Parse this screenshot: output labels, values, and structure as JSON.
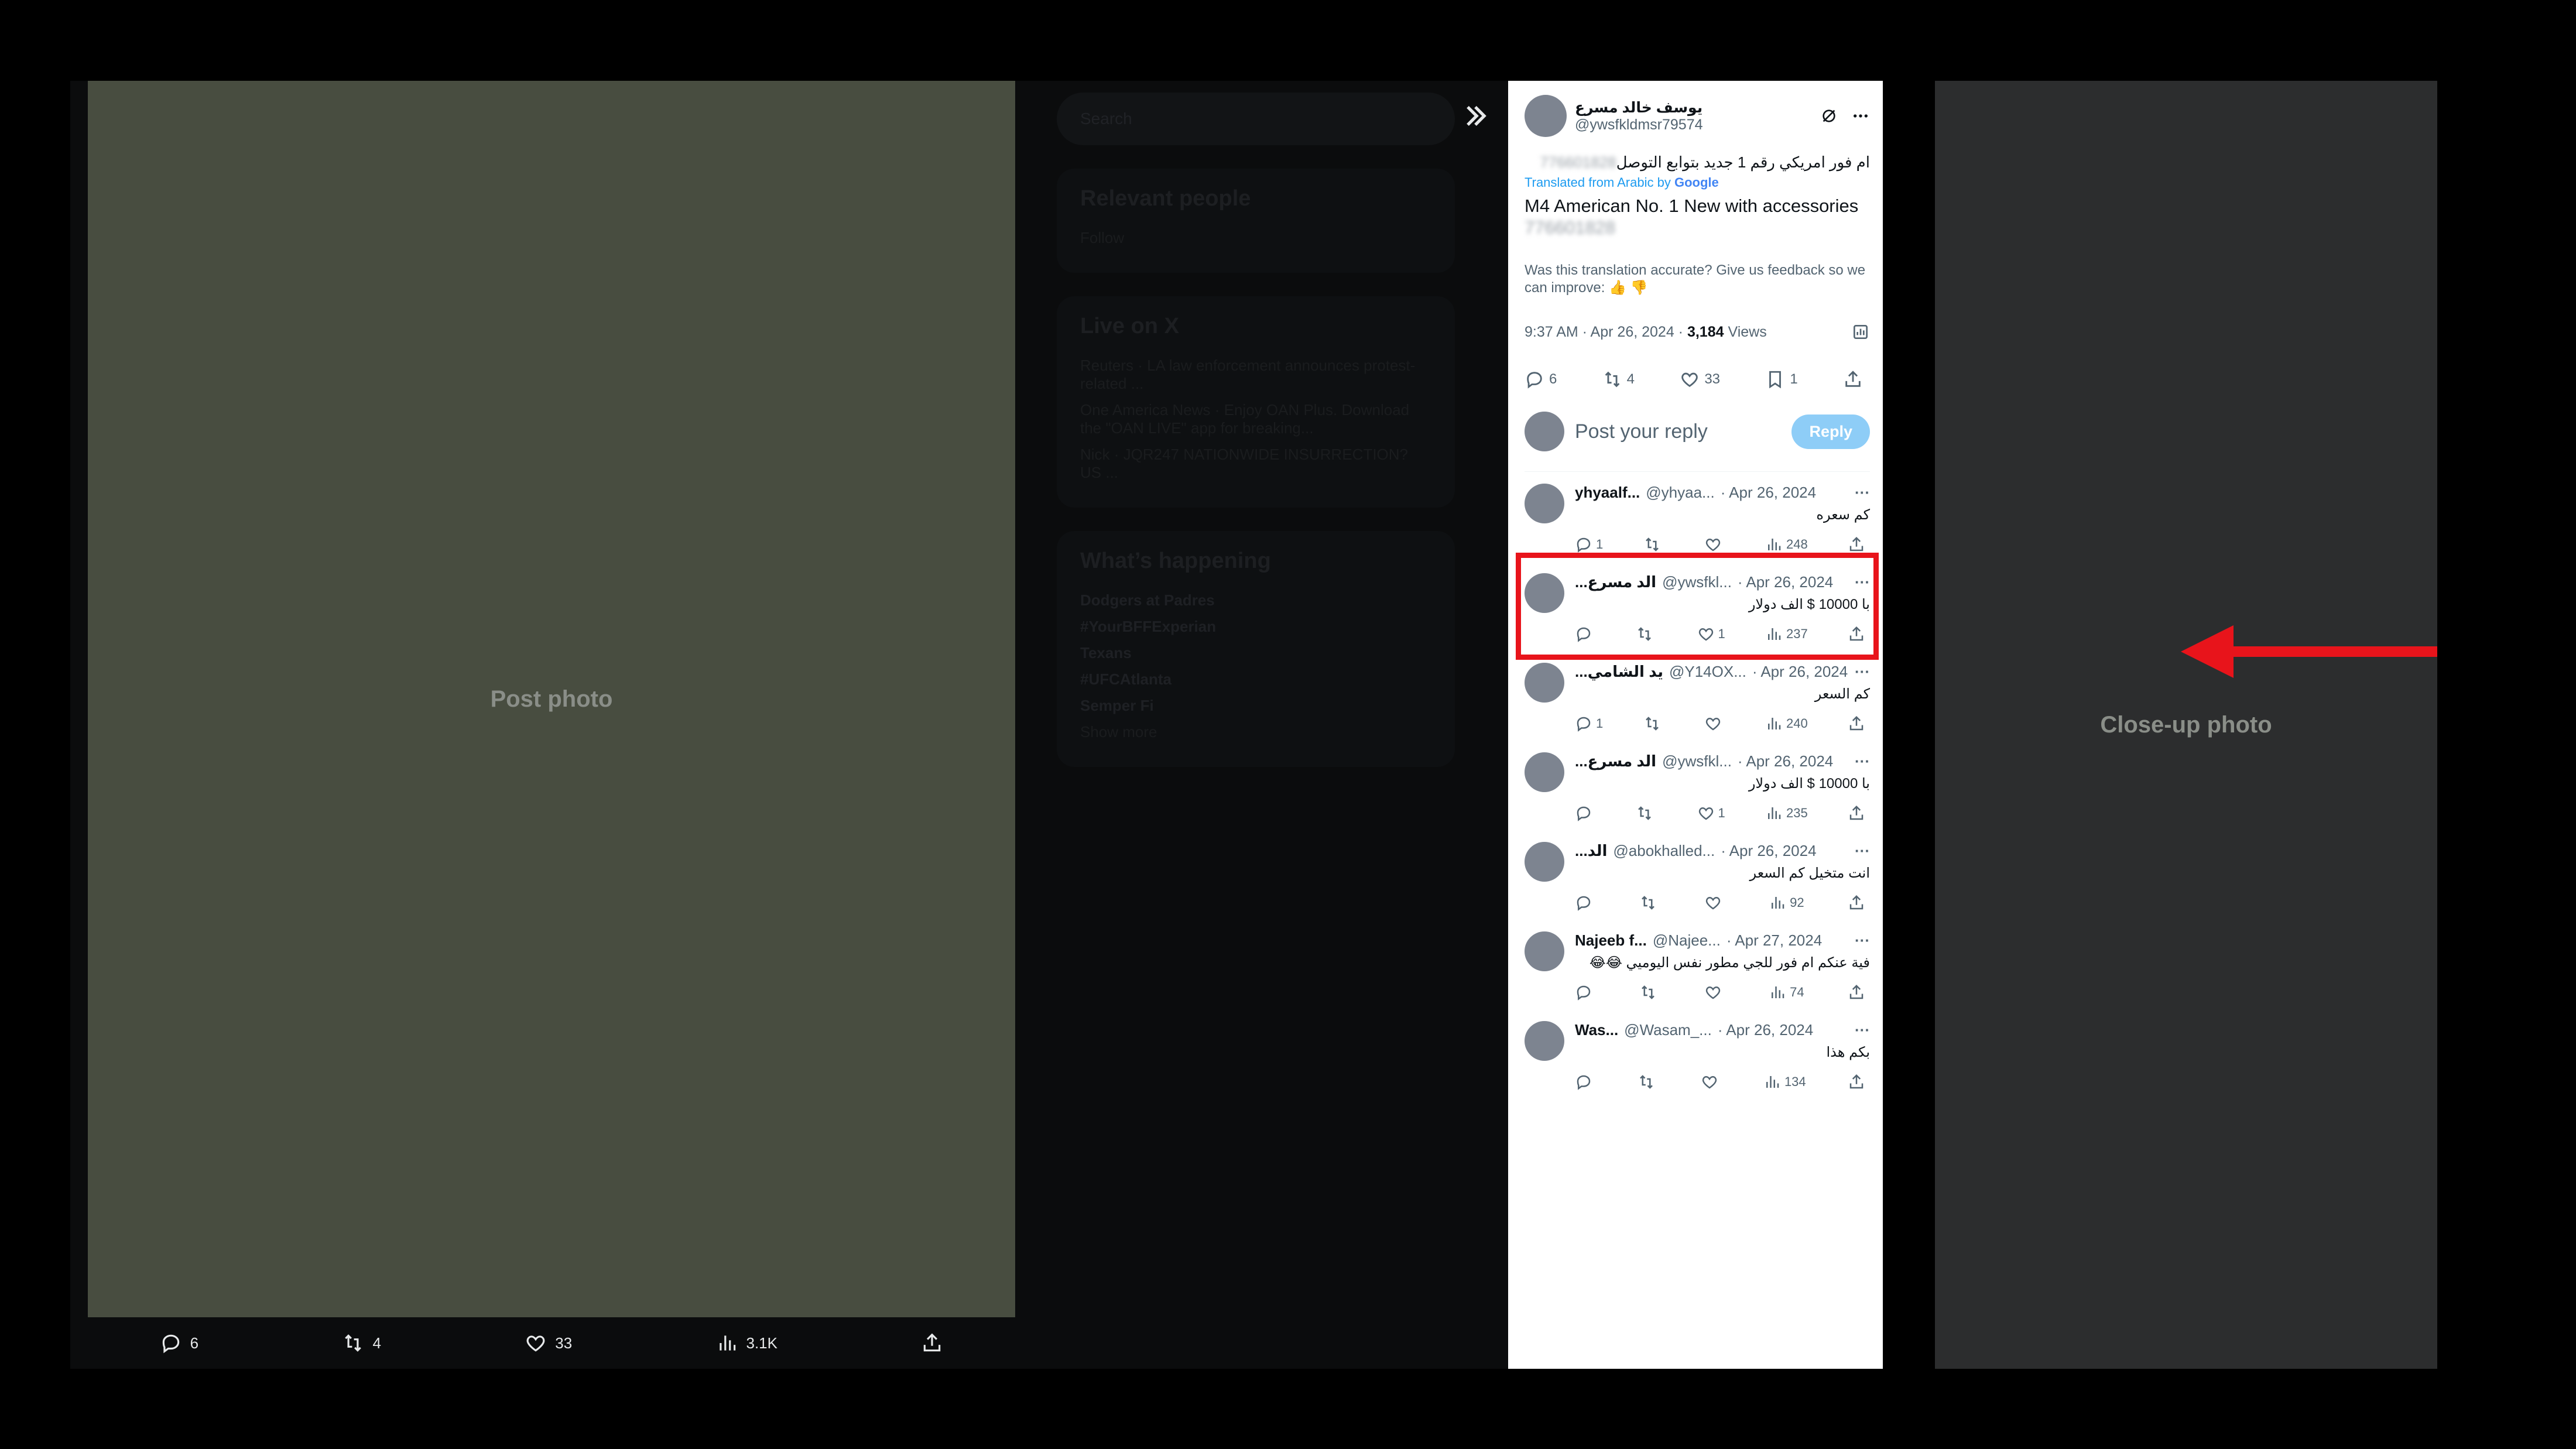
{
  "backdrop": {
    "search_placeholder": "Search",
    "relevant_people_title": "Relevant people",
    "follow_label": "Follow",
    "live_title": "Live on X",
    "live_items": [
      "Reuters · LA law enforcement announces protest-related ...",
      "One America News · Enjoy OAN Plus. Download the \"OAN LIVE\" app for breaking...",
      "Nick · JQR247 NATIONWIDE INSURRECTION? US ..."
    ],
    "whats_happening_title": "What’s happening",
    "trends": [
      "Dodgers at Padres",
      "#YourBFFExperian",
      "Texans",
      "#UFCAtlanta",
      "Semper Fi"
    ],
    "show_more": "Show more"
  },
  "viewer": {
    "main_photo_label": "Post photo",
    "closeup_photo_label": "Close-up photo",
    "actions": {
      "replies": "6",
      "reposts": "4",
      "likes": "33",
      "views": "3.1K"
    }
  },
  "tweet": {
    "author_name": "يوسف خالد مسرع",
    "author_handle": "@ywsfkldmsr79574",
    "text_ar": "ام فور امريكي رقم 1 جديد بتوابع التوصل",
    "text_ar_blurred": "776601828",
    "translated_from": "Translated from Arabic by",
    "google": "Google",
    "text_en": "M4 American No. 1 New with accessories",
    "text_en_blurred": "776601828",
    "feedback": "Was this translation accurate? Give us feedback so we can improve:",
    "timestamp": "9:37 AM · Apr 26, 2024 ·",
    "views_count": "3,184",
    "views_label": "Views",
    "stats": {
      "replies": "6",
      "reposts": "4",
      "likes": "33",
      "bookmarks": "1"
    },
    "reply_placeholder": "Post your reply",
    "reply_button": "Reply"
  },
  "replies": [
    {
      "name": "yhyaalf...",
      "handle": "@yhyaa...",
      "date": "· Apr 26, 2024",
      "text": "كم سعره",
      "replies": "1",
      "reposts": "",
      "likes": "",
      "views": "248",
      "highlight": false
    },
    {
      "name": "...الد مسرع",
      "handle": "@ywsfkl...",
      "date": "· Apr 26, 2024",
      "text": "با 10000 $ الف دولار",
      "replies": "",
      "reposts": "",
      "likes": "1",
      "views": "237",
      "highlight": true
    },
    {
      "name": "...يد الشامي",
      "handle": "@Y14OX...",
      "date": "· Apr 26, 2024",
      "text": "كم السعر",
      "replies": "1",
      "reposts": "",
      "likes": "",
      "views": "240",
      "highlight": false
    },
    {
      "name": "...الد مسرع",
      "handle": "@ywsfkl...",
      "date": "· Apr 26, 2024",
      "text": "با 10000 $ الف دولار",
      "replies": "",
      "reposts": "",
      "likes": "1",
      "views": "235",
      "highlight": false
    },
    {
      "name": "...الد",
      "handle": "@abokhalled...",
      "date": "· Apr 26, 2024",
      "text": "انت متخيل كم السعر",
      "replies": "",
      "reposts": "",
      "likes": "",
      "views": "92",
      "highlight": false
    },
    {
      "name": "Najeeb f...",
      "handle": "@Najee...",
      "date": "· Apr 27, 2024",
      "text": "فية عنكم ام فور للجي مطور نفس اليوميي 😂😂",
      "replies": "",
      "reposts": "",
      "likes": "",
      "views": "74",
      "highlight": false
    },
    {
      "name": "Was...",
      "handle": "@Wasam_...",
      "date": "· Apr 26, 2024",
      "text": "بكم هذا",
      "replies": "",
      "reposts": "",
      "likes": "",
      "views": "134",
      "highlight": false
    }
  ],
  "colors": {
    "highlight": "#e8141b",
    "accent": "#1d9bf0",
    "reply_button": "#8ecdf7"
  }
}
